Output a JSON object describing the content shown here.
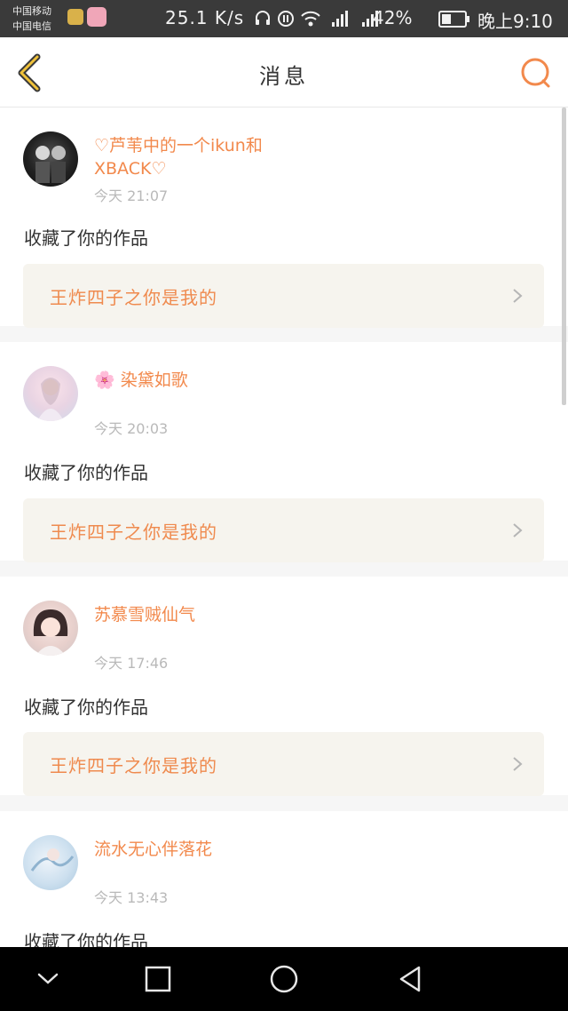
{
  "status_bar": {
    "carrier1": "中国移动",
    "carrier2": "中国电信",
    "net_speed": "25.1 K/s",
    "battery": "42%",
    "battery_level": 0.42,
    "time": "晚上9:10",
    "icons": [
      "headphones-icon",
      "hd-icon",
      "wifi-icon",
      "signal-icon",
      "signal-icon",
      "battery-icon"
    ]
  },
  "header": {
    "title": "消息",
    "back_icon": "chevron-left-icon",
    "search_icon": "search-icon"
  },
  "colors": {
    "accent": "#f2894c",
    "card_link_bg": "#f6f4ee",
    "time_gray": "#b9b9b9"
  },
  "messages": [
    {
      "name": "♡芦苇中的一个ikun和XBACK♡",
      "time": "今天 21:07",
      "action": "收藏了你的作品",
      "work": "王炸四子之你是我的"
    },
    {
      "name": "🌸 染黛如歌",
      "time": "今天 20:03",
      "action": "收藏了你的作品",
      "work": "王炸四子之你是我的"
    },
    {
      "name": "苏慕雪贼仙气",
      "time": "今天 17:46",
      "action": "收藏了你的作品",
      "work": "王炸四子之你是我的"
    },
    {
      "name": "流水无心伴落花",
      "time": "今天 13:43",
      "action": "收藏了你的作品",
      "work": ""
    }
  ],
  "nav_bar": {
    "buttons": [
      "collapse-icon",
      "recents-icon",
      "home-icon",
      "back-icon"
    ]
  }
}
